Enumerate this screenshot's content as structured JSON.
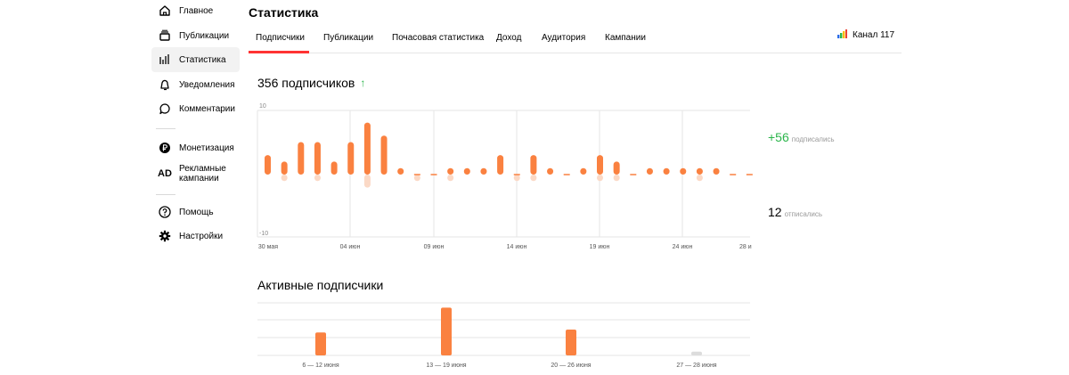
{
  "sidebar": {
    "items": [
      {
        "label": "Главное",
        "icon": "home-icon"
      },
      {
        "label": "Публикации",
        "icon": "publications-icon"
      },
      {
        "label": "Статистика",
        "icon": "stats-icon",
        "active": true
      },
      {
        "label": "Уведомления",
        "icon": "bell-icon"
      },
      {
        "label": "Комментарии",
        "icon": "comment-icon"
      },
      {
        "label": "Монетизация",
        "icon": "ruble-icon"
      },
      {
        "label": "Рекламные кампании",
        "icon": "ad-icon",
        "icon_text": "AD"
      },
      {
        "label": "Помощь",
        "icon": "help-icon"
      },
      {
        "label": "Настройки",
        "icon": "gear-icon"
      }
    ]
  },
  "header": {
    "title": "Статистика",
    "tabs": [
      "Подписчики",
      "Публикации",
      "Почасовая статистика",
      "Доход",
      "Аудитория",
      "Кампании"
    ],
    "active_tab": "Подписчики",
    "channel_name": "Канал 117"
  },
  "subscribers": {
    "heading": "356 подписчиков",
    "trend": "↑",
    "subscribed_value": "+56",
    "subscribed_label": "подписались",
    "unsubscribed_value": "12",
    "unsubscribed_label": "отписались"
  },
  "active": {
    "heading": "Активные подписчики"
  },
  "colors": {
    "accent": "#ff3333",
    "bar": "#fa8140",
    "bar_light": "#fbd9c6",
    "green": "#2bb54b",
    "grid": "#e6e6e6"
  },
  "chart_data": [
    {
      "type": "bar",
      "title": "",
      "ylim": [
        -10,
        10
      ],
      "y_tick_labels": [
        "10",
        "-10"
      ],
      "x_tick_labels": [
        "30 мая",
        "04 июн",
        "09 июн",
        "14 июн",
        "19 июн",
        "24 июн",
        "28 и"
      ],
      "series": [
        {
          "name": "подписались",
          "values": [
            3,
            2,
            5,
            5,
            2,
            5,
            8,
            6,
            1,
            0,
            0,
            1,
            1,
            1,
            3,
            0,
            3,
            1,
            0,
            1,
            3,
            2,
            0,
            1,
            1,
            1,
            1,
            1,
            0,
            0
          ]
        },
        {
          "name": "отписались",
          "values": [
            0,
            -1,
            0,
            -1,
            0,
            0,
            -2,
            0,
            0,
            -1,
            0,
            -1,
            0,
            0,
            0,
            -1,
            -1,
            0,
            0,
            0,
            -1,
            -1,
            0,
            0,
            0,
            0,
            -1,
            0,
            0,
            0
          ]
        }
      ]
    },
    {
      "type": "bar",
      "title": "",
      "categories": [
        "6 — 12 июня",
        "13 — 19 июня",
        "20 — 26 июня",
        "27 — 28 июня"
      ],
      "values": [
        24,
        50,
        27,
        4
      ]
    }
  ]
}
